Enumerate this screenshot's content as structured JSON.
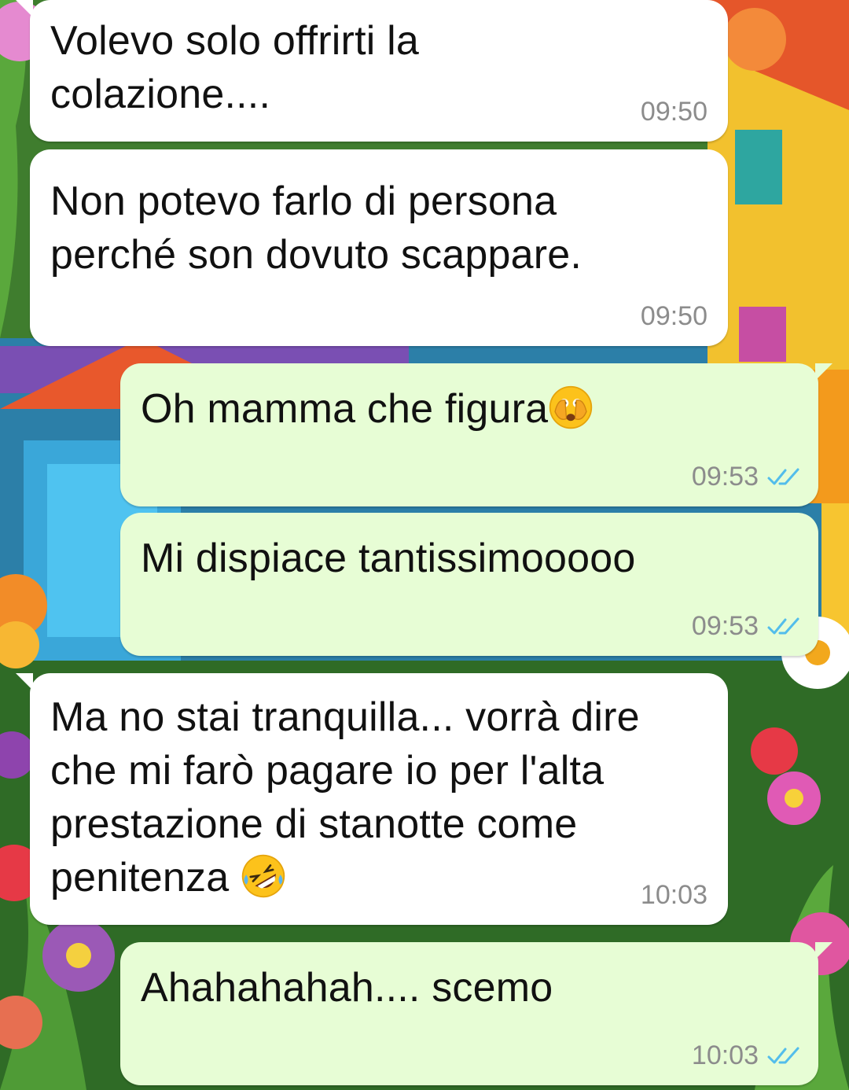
{
  "messages": [
    {
      "direction": "in",
      "text": "Volevo solo offrirti la\ncolazione....",
      "time": "09:50"
    },
    {
      "direction": "in",
      "text": "Non potevo farlo di persona\nperché son dovuto scappare.",
      "time": "09:50"
    },
    {
      "direction": "out",
      "text": "Oh mamma che figura",
      "emoji": "face-with-open-eyes-and-hand-over-mouth",
      "time": "09:53",
      "status": "read"
    },
    {
      "direction": "out",
      "text": "Mi dispiace tantissimooooo",
      "time": "09:53",
      "status": "read"
    },
    {
      "direction": "in",
      "text": "Ma no stai tranquilla... vorrà dire\nche mi farò pagare io per l'alta\nprestazione di stanotte come\npenitenza ",
      "emoji": "rolling-on-the-floor-laughing",
      "time": "10:03"
    },
    {
      "direction": "out",
      "text": "Ahahahahah.... scemo",
      "time": "10:03",
      "status": "read"
    }
  ],
  "colors": {
    "incoming_bubble": "#ffffff",
    "outgoing_bubble": "#e7fdd5",
    "timestamp": "#8c8c8c",
    "read_ticks": "#53bdeb"
  }
}
